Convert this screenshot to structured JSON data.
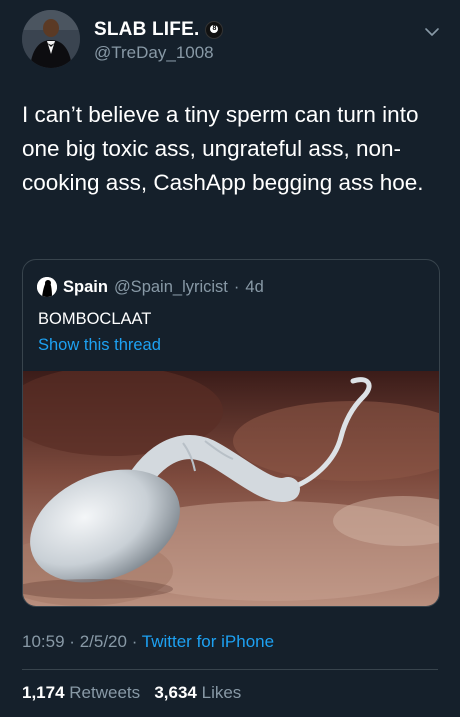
{
  "tweet": {
    "display_name": "SLAB LIFE.",
    "badge_icon": "eight-ball-icon",
    "handle": "@TreDay_1008",
    "text": "I can’t believe a tiny sperm can turn into one big toxic ass, ungrateful ass, non-cooking ass, CashApp begging ass hoe.",
    "time": "10:59",
    "date": "2/5/20",
    "source": "Twitter for iPhone",
    "retweets_count": "1,174",
    "retweets_label": "Retweets",
    "likes_count": "3,634",
    "likes_label": "Likes"
  },
  "quoted": {
    "display_name": "Spain",
    "handle": "@Spain_lyricist",
    "age": "4d",
    "text": "BOMBOCLAAT",
    "thread_link": "Show this thread",
    "media_icon": "sperm-cell-image"
  },
  "colors": {
    "background": "#15202b",
    "secondary_text": "#8899a6",
    "link": "#1da1f2",
    "border": "#38444d"
  }
}
